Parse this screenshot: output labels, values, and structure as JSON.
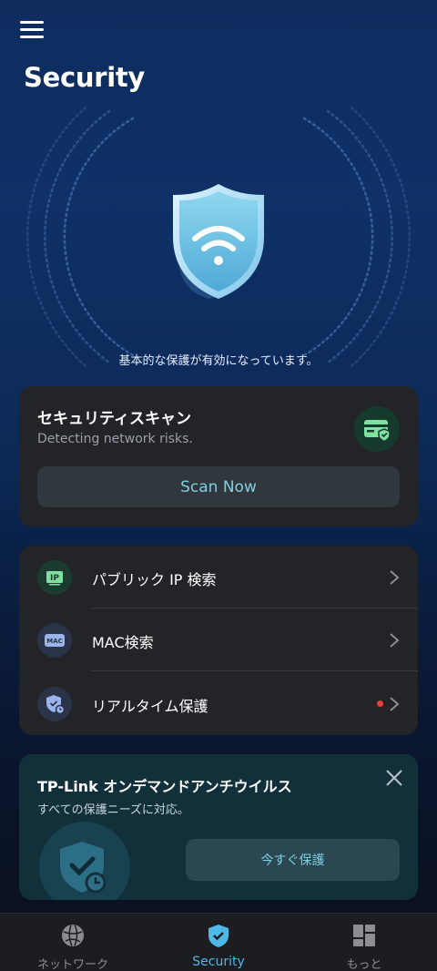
{
  "header": {
    "title": "Security"
  },
  "hero": {
    "status_text": "基本的な保護が有効になっています。"
  },
  "scan_card": {
    "title": "セキュリティスキャン",
    "subtitle": "Detecting network risks.",
    "button_label": "Scan Now"
  },
  "tools": {
    "items": [
      {
        "label": "パブリック IP 検索",
        "icon": "ip-icon",
        "badge_text": "IP"
      },
      {
        "label": "MAC検索",
        "icon": "mac-icon",
        "badge_text": "MAC"
      },
      {
        "label": "リアルタイム保護",
        "icon": "shield-clock-icon",
        "has_alert_dot": true
      }
    ]
  },
  "promo": {
    "title": "TP-Link オンデマンドアンチウイルス",
    "subtitle": "すべての保護ニーズに対応。",
    "button_label": "今すぐ保護"
  },
  "tabbar": {
    "tabs": [
      {
        "label": "ネットワーク",
        "icon": "globe-icon",
        "active": false
      },
      {
        "label": "Security",
        "icon": "shield-check-icon",
        "active": true
      },
      {
        "label": "もっと",
        "icon": "grid-icon",
        "active": false
      }
    ]
  },
  "colors": {
    "accent": "#4fb8e6",
    "card_bg": "#222428",
    "promo_bg": "#12303a",
    "alert_dot": "#e8413b"
  }
}
